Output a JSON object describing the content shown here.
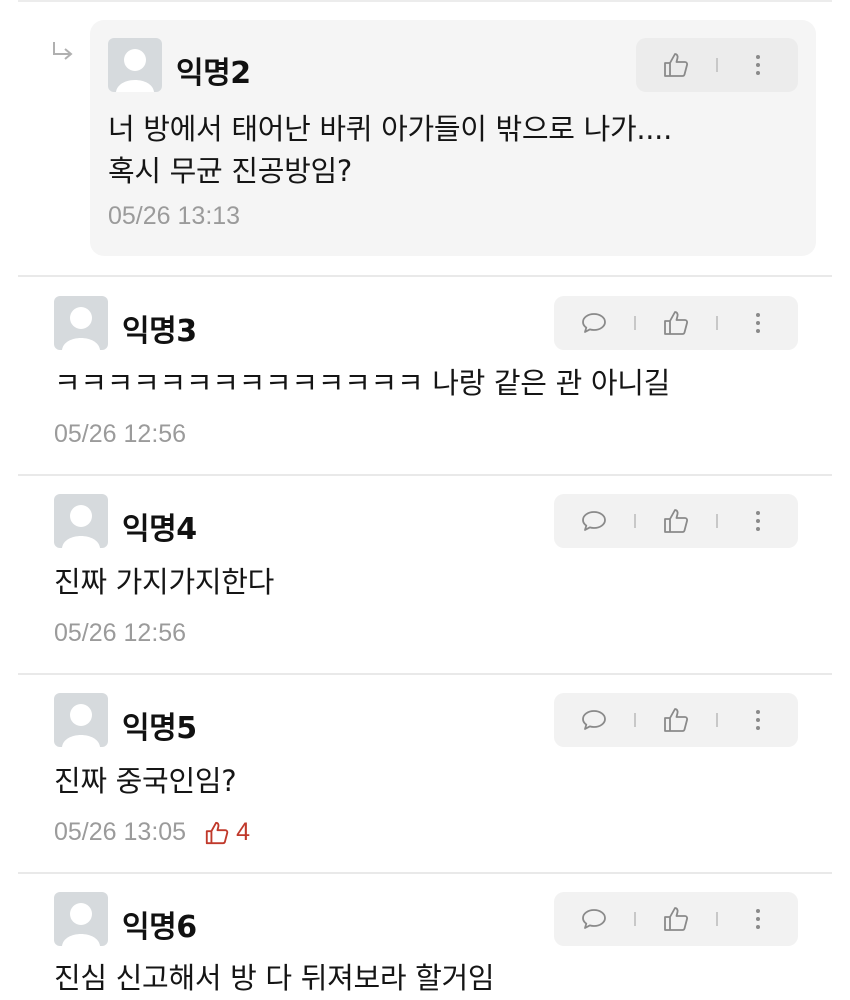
{
  "comments": [
    {
      "author": "익명2",
      "body": "너 방에서 태어난 바퀴 아가들이 밖으로 나가....\n혹시 무균 진공방임?",
      "time": "05/26 13:13",
      "likes": ""
    },
    {
      "author": "익명3",
      "body": "ㅋㅋㅋㅋㅋㅋㅋㅋㅋㅋㅋㅋㅋㅋ 나랑 같은 관 아니길",
      "time": "05/26 12:56",
      "likes": ""
    },
    {
      "author": "익명4",
      "body": "진짜 가지가지한다",
      "time": "05/26 12:56",
      "likes": ""
    },
    {
      "author": "익명5",
      "body": "진짜 중국인임?",
      "time": "05/26 13:05",
      "likes": "4"
    },
    {
      "author": "익명6",
      "body": "진심 신고해서 방 다 뒤져보라 할거임",
      "time": "",
      "likes": ""
    }
  ],
  "icons": {
    "reply_arrow": "reply-arrow-icon",
    "avatar": "default-avatar",
    "comment": "speech-bubble-icon",
    "like": "thumbs-up-icon",
    "more": "vertical-ellipsis-icon"
  },
  "colors": {
    "like_accent": "#c0392b",
    "meta_gray": "#9b9b9b",
    "reply_bg": "#f5f5f5"
  }
}
